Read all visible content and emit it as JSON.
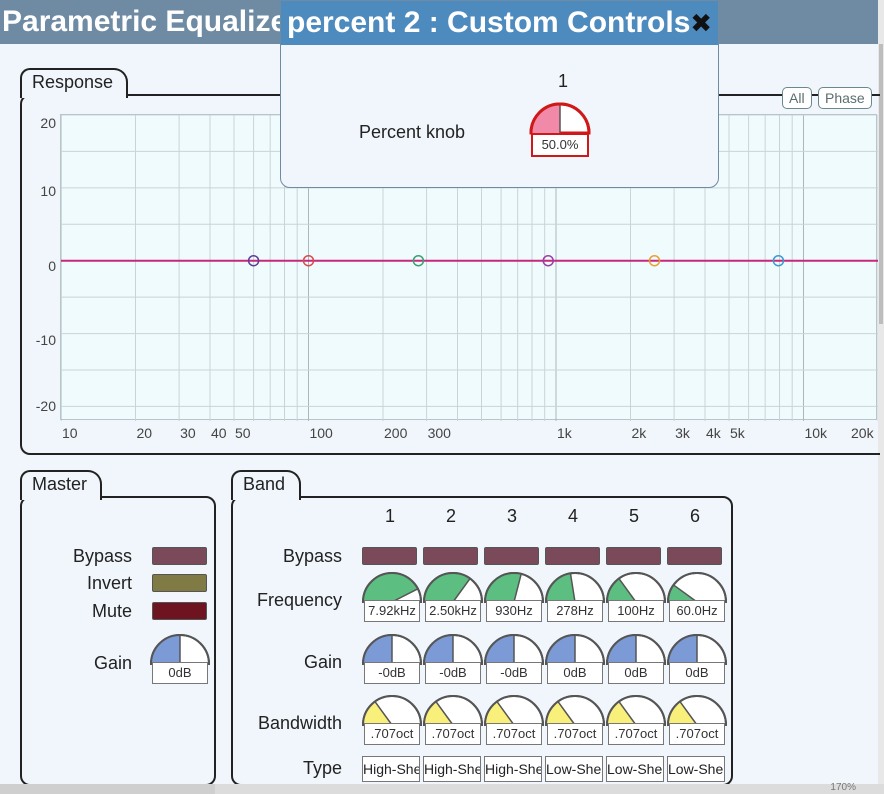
{
  "window": {
    "title": "Parametric Equalizer"
  },
  "popup": {
    "title": "percent 2 : Custom Controls",
    "close_glyph": "✖",
    "column": "1",
    "label": "Percent knob",
    "knob": {
      "value": 0.5,
      "text": "50.0%",
      "color": "#f08aa8"
    }
  },
  "response": {
    "tab": "Response",
    "buttons": {
      "all": "All",
      "phase": "Phase"
    },
    "y_ticks": [
      "20",
      "10",
      "0",
      "-10",
      "-20"
    ],
    "x_ticks": [
      "10",
      "20",
      "30",
      "40",
      "50",
      "100",
      "200",
      "300",
      "1k",
      "2k",
      "3k",
      "4k",
      "5k",
      "10k",
      "20k"
    ],
    "ylim": [
      -22,
      20
    ],
    "markers": [
      {
        "band": "6",
        "freq": 60,
        "color": "#5a3e9a"
      },
      {
        "band": "5",
        "freq": 100,
        "color": "#d94a4a"
      },
      {
        "band": "4",
        "freq": 278,
        "color": "#3aa070"
      },
      {
        "band": "3",
        "freq": 930,
        "color": "#9a3ea8"
      },
      {
        "band": "2",
        "freq": 2500,
        "color": "#e8a030"
      },
      {
        "band": "1",
        "freq": 7920,
        "color": "#3a9ad0"
      }
    ],
    "curve_color": "#c8287a"
  },
  "master": {
    "tab": "Master",
    "bypass": {
      "label": "Bypass",
      "color": "#7a4a5a"
    },
    "invert": {
      "label": "Invert",
      "color": "#807a45"
    },
    "mute": {
      "label": "Mute",
      "color": "#6e1420"
    },
    "gain": {
      "label": "Gain",
      "value": 0.5,
      "text": "0dB",
      "color": "#7b9ad6"
    }
  },
  "band": {
    "tab": "Band",
    "labels": {
      "bypass": "Bypass",
      "frequency": "Frequency",
      "gain": "Gain",
      "bandwidth": "Bandwidth",
      "type": "Type"
    },
    "bypass_color": "#7a4a5a",
    "freq_color": "#5cbe80",
    "gain_color": "#7b9ad6",
    "bw_color": "#f8f07a",
    "columns": [
      {
        "num": "1",
        "freq": {
          "value": 0.85,
          "text": "7.92kHz"
        },
        "gain": {
          "value": 0.5,
          "text": "-0dB"
        },
        "bw": {
          "value": 0.3,
          "text": ".707oct"
        },
        "type": "High-Shelf"
      },
      {
        "num": "2",
        "freq": {
          "value": 0.7,
          "text": "2.50kHz"
        },
        "gain": {
          "value": 0.5,
          "text": "-0dB"
        },
        "bw": {
          "value": 0.3,
          "text": ".707oct"
        },
        "type": "High-Shelf"
      },
      {
        "num": "3",
        "freq": {
          "value": 0.58,
          "text": "930Hz"
        },
        "gain": {
          "value": 0.5,
          "text": "-0dB"
        },
        "bw": {
          "value": 0.3,
          "text": ".707oct"
        },
        "type": "High-Shelf"
      },
      {
        "num": "4",
        "freq": {
          "value": 0.45,
          "text": "278Hz"
        },
        "gain": {
          "value": 0.5,
          "text": "0dB"
        },
        "bw": {
          "value": 0.3,
          "text": ".707oct"
        },
        "type": "Low-Shelf"
      },
      {
        "num": "5",
        "freq": {
          "value": 0.3,
          "text": "100Hz"
        },
        "gain": {
          "value": 0.5,
          "text": "0dB"
        },
        "bw": {
          "value": 0.3,
          "text": ".707oct"
        },
        "type": "Low-Shelf"
      },
      {
        "num": "6",
        "freq": {
          "value": 0.2,
          "text": "60.0Hz"
        },
        "gain": {
          "value": 0.5,
          "text": "0dB"
        },
        "bw": {
          "value": 0.3,
          "text": ".707oct"
        },
        "type": "Low-Shelf"
      }
    ]
  },
  "statusbar": {
    "zoom": "170%"
  }
}
